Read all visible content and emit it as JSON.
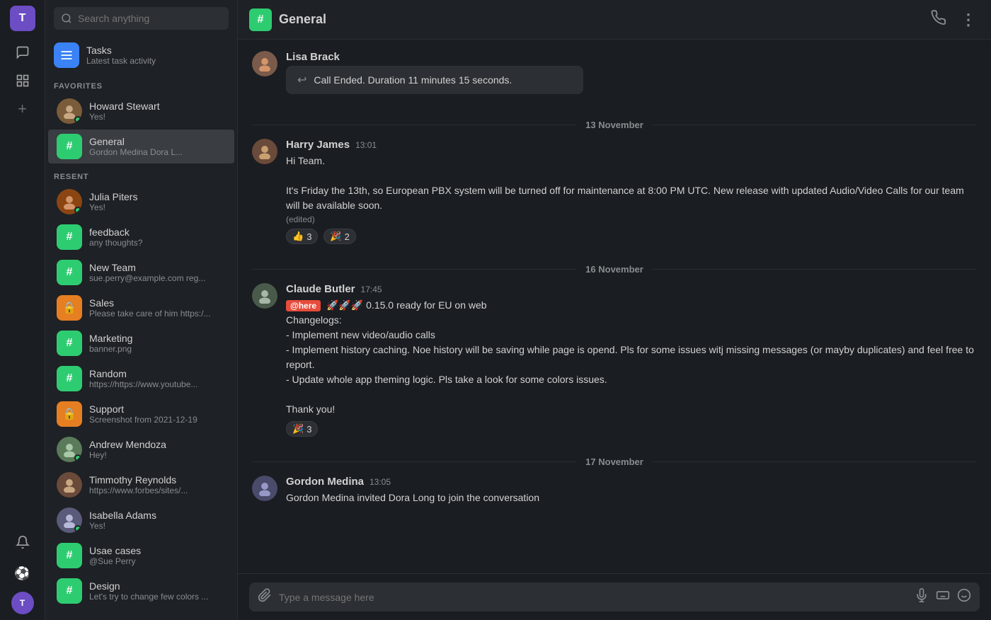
{
  "app": {
    "user_initial": "T",
    "title": "General"
  },
  "iconbar": {
    "chat_icon": "💬",
    "grid_icon": "⊞",
    "add_icon": "+",
    "bell_icon": "🔔",
    "soccer_icon": "⚽"
  },
  "sidebar": {
    "search_placeholder": "Search anything",
    "tasks": {
      "name": "Tasks",
      "subtitle": "Latest task activity"
    },
    "favorites_label": "FAVORITES",
    "favorites": [
      {
        "id": "howard",
        "name": "Howard Stewart",
        "preview": "Yes!",
        "type": "user",
        "online": true
      },
      {
        "id": "general",
        "name": "General",
        "preview": "Gordon Medina Dora L...",
        "type": "channel",
        "active": true
      }
    ],
    "recent_label": "RESENT",
    "recent": [
      {
        "id": "julia",
        "name": "Julia Piters",
        "preview": "Yes!",
        "type": "user",
        "online": true
      },
      {
        "id": "feedback",
        "name": "feedback",
        "preview": "any thoughts?",
        "type": "channel"
      },
      {
        "id": "newteam",
        "name": "New Team",
        "preview": "sue.perry@example.com reg...",
        "type": "channel"
      },
      {
        "id": "sales",
        "name": "Sales",
        "preview": "Please take care of him https:/...",
        "type": "channel-locked",
        "color": "orange"
      },
      {
        "id": "marketing",
        "name": "Marketing",
        "preview": "banner.png",
        "type": "channel"
      },
      {
        "id": "random",
        "name": "Random",
        "preview": "https://https://www.youtube...",
        "type": "channel"
      },
      {
        "id": "support",
        "name": "Support",
        "preview": "Screenshot from 2021-12-19",
        "type": "channel-locked",
        "color": "orange"
      },
      {
        "id": "andrew",
        "name": "Andrew Mendoza",
        "preview": "Hey!",
        "type": "user",
        "online": true
      },
      {
        "id": "timmothy",
        "name": "Timmothy Reynolds",
        "preview": "https://www.forbes/sites/...",
        "type": "user",
        "online": false
      },
      {
        "id": "isabella",
        "name": "Isabella Adams",
        "preview": "Yes!",
        "type": "user",
        "online": true
      },
      {
        "id": "usecases",
        "name": "Usae cases",
        "preview": "@Sue Perry",
        "type": "channel"
      },
      {
        "id": "design",
        "name": "Design",
        "preview": "Let's try to change few colors ...",
        "type": "channel"
      }
    ]
  },
  "chat": {
    "header_name": "General",
    "header_hash": "#",
    "phone_icon": "📞",
    "more_icon": "⋮",
    "messages": [
      {
        "id": "call-ended",
        "type": "system-call",
        "sender": "Lisa Brack",
        "text": "Call Ended. Duration 11 minutes 15 seconds."
      },
      {
        "id": "date-13",
        "type": "date-divider",
        "label": "13 November"
      },
      {
        "id": "msg-harry",
        "type": "message",
        "author": "Harry James",
        "time": "13:01",
        "lines": [
          "Hi Team.",
          "",
          "It's Friday the 13th, so European PBX system will be turned off for maintenance at 8:00 PM UTC. New release with updated Audio/Video Calls for our team will be available soon."
        ],
        "edited": true,
        "reactions": [
          {
            "emoji": "👍",
            "count": 3
          },
          {
            "emoji": "🎉",
            "count": 2
          }
        ]
      },
      {
        "id": "date-16",
        "type": "date-divider",
        "label": "16  November"
      },
      {
        "id": "msg-claude",
        "type": "message",
        "author": "Claude Butler",
        "time": "17:45",
        "here_mention": "@here",
        "lines": [
          "🚀🚀🚀 0.15.0 ready for EU on web",
          "Changelogs:",
          "- Implement new video/audio calls",
          "- Implement history caching. Noe history will be saving while page is opend. Pls for some issues witj missing messages (or mayby duplicates) and  feel free to report.",
          "- Update whole app theming logic. Pls take a look for some colors issues.",
          "",
          "Thank you!"
        ],
        "reactions": [
          {
            "emoji": "🎉",
            "count": 3
          }
        ]
      },
      {
        "id": "date-17",
        "type": "date-divider",
        "label": "17  November"
      },
      {
        "id": "msg-gordon",
        "type": "message",
        "author": "Gordon Medina",
        "time": "13:05",
        "lines": [
          "Gordon Medina invited Dora Long to join the conversation"
        ]
      }
    ],
    "input_placeholder": "Type a message here"
  }
}
